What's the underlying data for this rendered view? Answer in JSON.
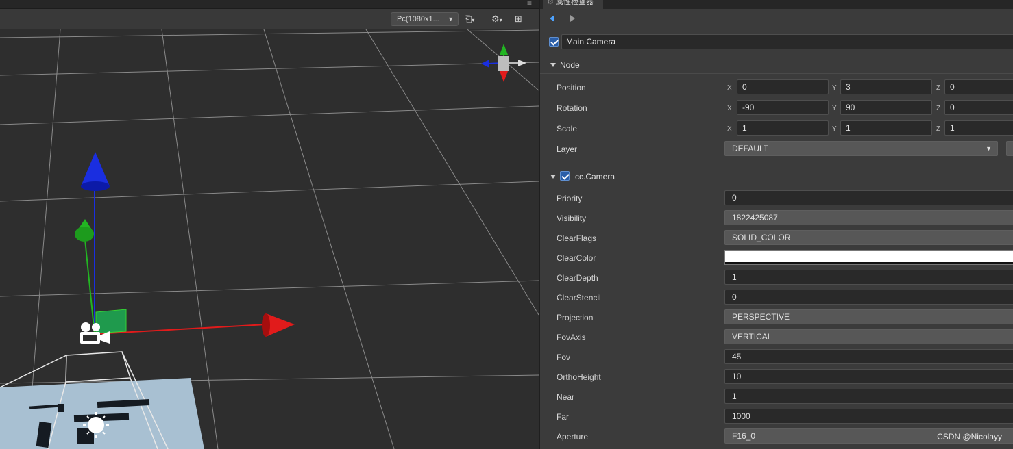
{
  "scene": {
    "resolution": "Pc(1080x1...",
    "menu_icon": "hamburger-menu-icon"
  },
  "inspector": {
    "tab_title": "属性检查器",
    "node_name": "Main Camera",
    "node_active": true,
    "node_section": {
      "title": "Node",
      "position": {
        "label": "Position",
        "x": "0",
        "y": "3",
        "z": "0"
      },
      "rotation": {
        "label": "Rotation",
        "x": "-90",
        "y": "90",
        "z": "0"
      },
      "scale": {
        "label": "Scale",
        "x": "1",
        "y": "1",
        "z": "1"
      },
      "layer": {
        "label": "Layer",
        "value": "DEFAULT"
      }
    },
    "camera_section": {
      "title": "cc.Camera",
      "enabled": true,
      "props": {
        "priority": {
          "label": "Priority",
          "value": "0"
        },
        "visibility": {
          "label": "Visibility",
          "value": "1822425087"
        },
        "clear_flags": {
          "label": "ClearFlags",
          "value": "SOLID_COLOR"
        },
        "clear_color": {
          "label": "ClearColor",
          "value": "#ffffff"
        },
        "clear_depth": {
          "label": "ClearDepth",
          "value": "1"
        },
        "clear_stencil": {
          "label": "ClearStencil",
          "value": "0"
        },
        "projection": {
          "label": "Projection",
          "value": "PERSPECTIVE"
        },
        "fov_axis": {
          "label": "FovAxis",
          "value": "VERTICAL"
        },
        "fov": {
          "label": "Fov",
          "value": "45"
        },
        "ortho_height": {
          "label": "OrthoHeight",
          "value": "10"
        },
        "near": {
          "label": "Near",
          "value": "1"
        },
        "far": {
          "label": "Far",
          "value": "1000"
        },
        "aperture": {
          "label": "Aperture",
          "value": "F16_0"
        }
      }
    },
    "axis_labels": {
      "x": "X",
      "y": "Y",
      "z": "Z"
    }
  },
  "watermark": "CSDN @Nicolayy",
  "colors": {
    "accent": "#4ea3ff",
    "x_axis": "#e11b1b",
    "y_axis": "#22b522",
    "z_axis": "#1a2ee0"
  }
}
